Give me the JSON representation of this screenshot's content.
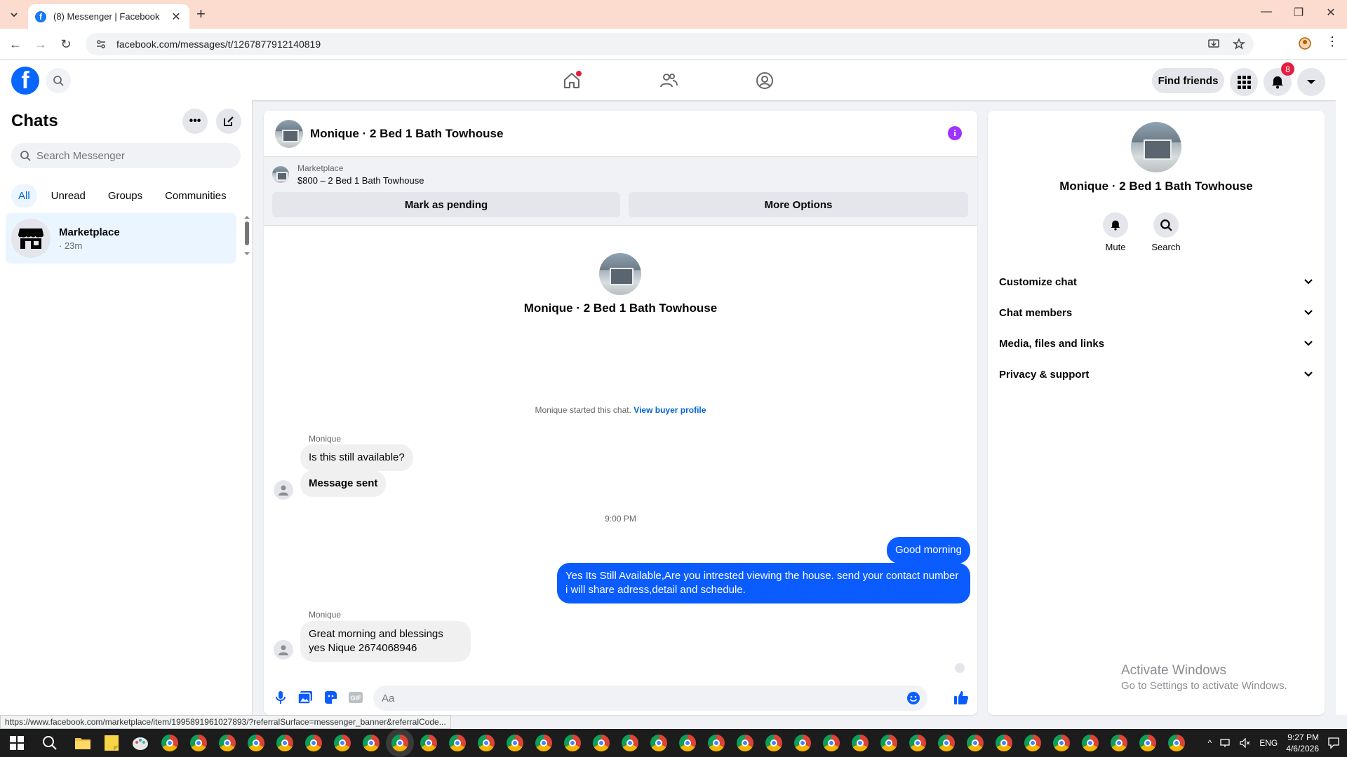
{
  "browser": {
    "tab_title": "(8) Messenger | Facebook",
    "favicon_letter": "f",
    "url": "facebook.com/messages/t/1267877912140819",
    "status_url": "https://www.facebook.com/marketplace/item/1995891961027893/?referralSurface=messenger_banner&referralCode..."
  },
  "header": {
    "logo_letter": "f",
    "find_friends_label": "Find friends",
    "notification_count": "8",
    "brand_color": "#0866ff"
  },
  "sidebar": {
    "title": "Chats",
    "search_placeholder": "Search Messenger",
    "filters": [
      "All",
      "Unread",
      "Groups",
      "Communities"
    ],
    "active_filter": "All",
    "conversations": [
      {
        "name": "Marketplace",
        "meta": "· 23m",
        "icon": "storefront-icon"
      }
    ]
  },
  "chat": {
    "name": "Monique · 2 Bed 1 Bath Towhouse",
    "marketplace_label": "Marketplace",
    "listing": "$800 – 2 Bed 1 Bath Towhouse",
    "mark_pending_label": "Mark as pending",
    "more_options_label": "More Options",
    "intro_name": "Monique · 2 Bed 1 Bath Towhouse",
    "started_text": "Monique started this chat.",
    "view_profile_label": "View buyer profile",
    "messages": [
      {
        "sender": "Monique",
        "text": "Is this still available?",
        "direction": "in"
      },
      {
        "text": "Message sent",
        "direction": "in"
      },
      {
        "timestamp": "9:00 PM"
      },
      {
        "text": "Good morning",
        "direction": "out"
      },
      {
        "text": "Yes Its Still Available,Are you intrested viewing the house. send your contact number i will share adress,detail and schedule.",
        "direction": "out"
      },
      {
        "sender": "Monique",
        "text": "Great morning and blessings yes Nique 2674068946",
        "direction": "in"
      }
    ],
    "composer_placeholder": "Aa",
    "outgoing_color": "#0a5cff",
    "accent_color": "#a033ff"
  },
  "info_panel": {
    "name": "Monique · 2 Bed 1 Bath Towhouse",
    "actions": [
      "Mute",
      "Search"
    ],
    "sections": [
      "Customize chat",
      "Chat members",
      "Media, files and links",
      "Privacy & support"
    ]
  },
  "watermark": {
    "line1": "Activate Windows",
    "line2": "Go to Settings to activate Windows."
  },
  "taskbar": {
    "language": "ENG",
    "time": "9:27 PM",
    "date": "4/6/2026"
  }
}
